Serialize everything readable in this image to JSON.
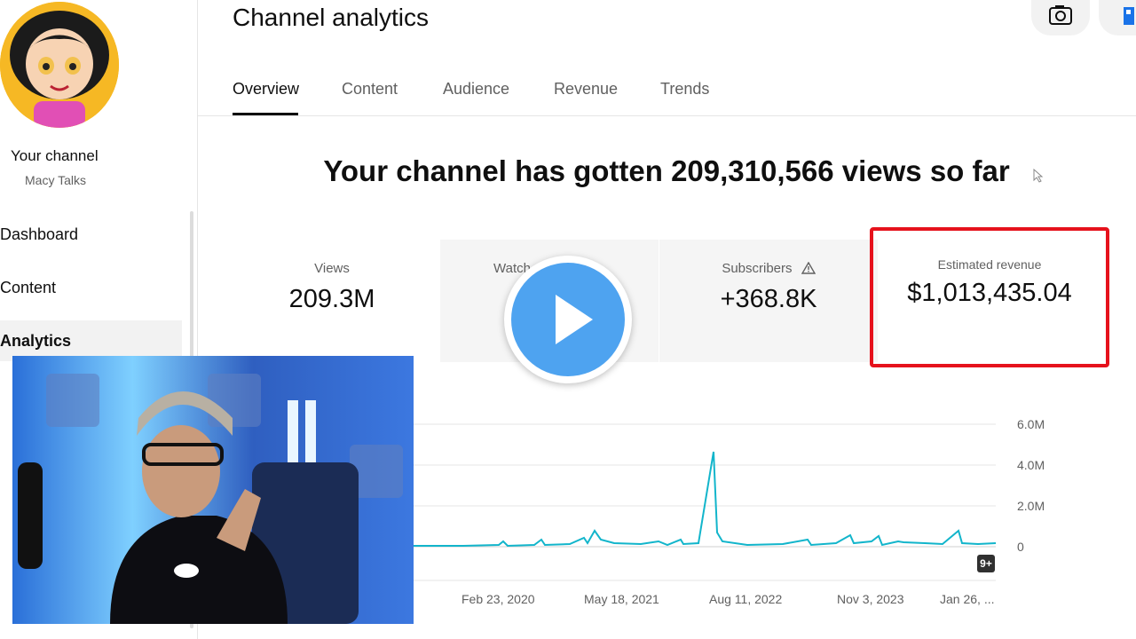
{
  "header": {
    "title": "Channel analytics"
  },
  "sidebar": {
    "channel_label": "Your channel",
    "channel_name": "Macy Talks",
    "items": [
      {
        "label": "Dashboard"
      },
      {
        "label": "Content"
      },
      {
        "label": "Analytics"
      }
    ]
  },
  "tabs": [
    {
      "label": "Overview"
    },
    {
      "label": "Content"
    },
    {
      "label": "Audience"
    },
    {
      "label": "Revenue"
    },
    {
      "label": "Trends"
    }
  ],
  "headline": "Your channel has gotten 209,310,566 views so far",
  "metrics": {
    "views": {
      "label": "Views",
      "value": "209.3M"
    },
    "watch": {
      "label": "Watch"
    },
    "subscribers": {
      "label": "Subscribers",
      "value": "+368.8K"
    },
    "revenue": {
      "label": "Estimated revenue",
      "value": "$1,013,435.04"
    }
  },
  "chart_data": {
    "type": "line",
    "ylabels": [
      "6.0M",
      "4.0M",
      "2.0M",
      "0"
    ],
    "xlabels": [
      "Feb 23, 2020",
      "May 18, 2021",
      "Aug 11, 2022",
      "Nov 3, 2023",
      "Jan 26, ..."
    ],
    "badge": "9+",
    "series_color": "#12b5cb",
    "grid": true
  },
  "colors": {
    "accent_red": "#e6121c",
    "play_blue": "#4ea3f0",
    "line": "#12b5cb"
  }
}
